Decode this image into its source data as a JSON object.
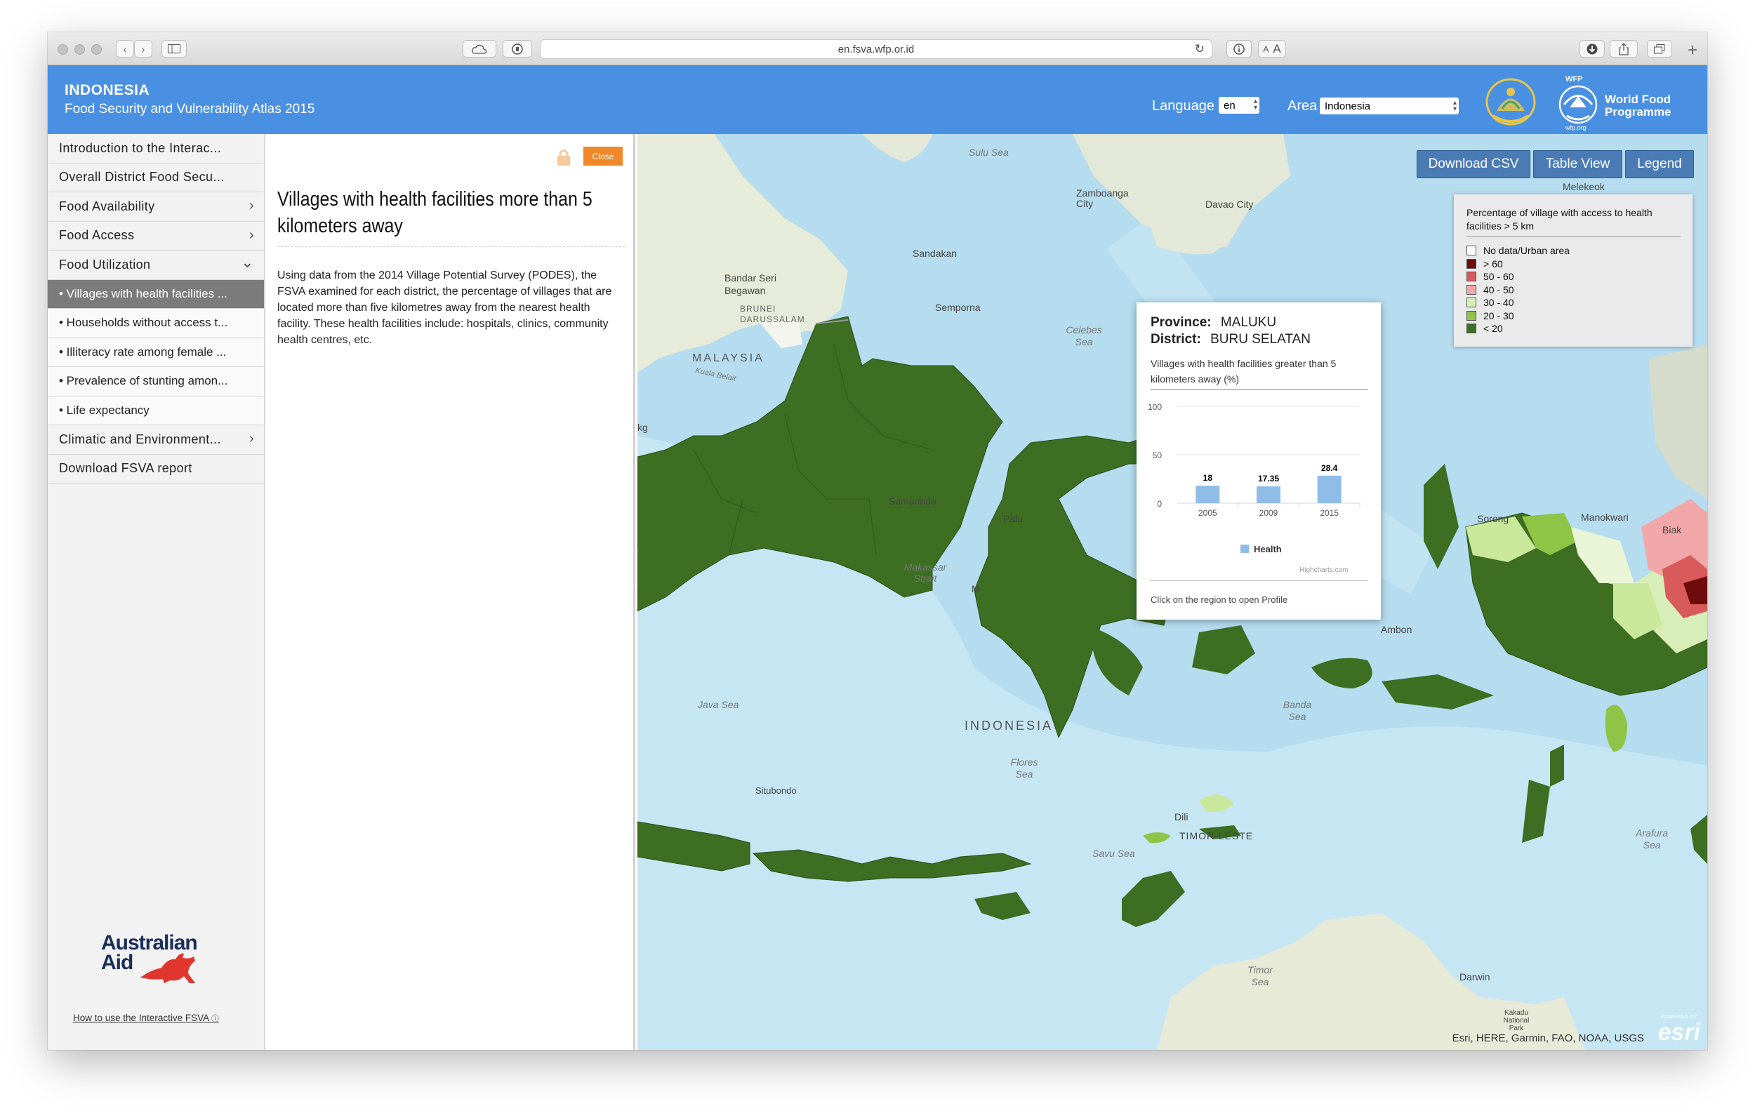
{
  "browser": {
    "url": "en.fsva.wfp.or.id",
    "reader_small": "A",
    "reader_large": "A"
  },
  "header": {
    "title": "INDONESIA",
    "subtitle": "Food Security and Vulnerability Atlas 2015",
    "language_label": "Language",
    "language_value": "en",
    "area_label": "Area",
    "area_value": "Indonesia",
    "wfp_top": "WFP",
    "wfp_line1": "World Food",
    "wfp_line2": "Programme",
    "wfp_url": "wfp.org"
  },
  "sidebar": {
    "items": [
      {
        "label": "Introduction to the Interac...",
        "type": "main"
      },
      {
        "label": "Overall District Food Secu...",
        "type": "main"
      },
      {
        "label": "Food Availability",
        "type": "main",
        "chevron": "›"
      },
      {
        "label": "Food Access",
        "type": "main",
        "chevron": "›"
      },
      {
        "label": "Food Utilization",
        "type": "main",
        "chevron": "⌄"
      },
      {
        "label": "• Villages with health facilities ...",
        "type": "sub",
        "active": true
      },
      {
        "label": "• Households without access t...",
        "type": "sub"
      },
      {
        "label": "• Illiteracy rate among female ...",
        "type": "sub"
      },
      {
        "label": "• Prevalence of stunting amon...",
        "type": "sub"
      },
      {
        "label": "• Life expectancy",
        "type": "sub"
      },
      {
        "label": "Climatic and Environment...",
        "type": "main",
        "chevron": "›"
      },
      {
        "label": "Download FSVA report",
        "type": "main"
      }
    ],
    "aid_line1": "Australian",
    "aid_line2": "Aid",
    "help_link": "How to use the Interactive FSVA"
  },
  "panel": {
    "close_label": "Close",
    "title": "Villages with health facilities more than 5 kilometers away",
    "body": "Using data from the 2014 Village Potential Survey (PODES), the FSVA examined for each district, the percentage of villages that are located more than five kilometres away from the nearest health facility. These health facilities include: hospitals, clinics, community health centres, etc."
  },
  "map": {
    "buttons": {
      "csv": "Download CSV",
      "table": "Table View",
      "legend": "Legend"
    },
    "legend": {
      "title": "Percentage of village with access to health facilities > 5 km",
      "items": [
        {
          "label": "No data/Urban area",
          "color": "#ffffff"
        },
        {
          "label": "> 60",
          "color": "#6e0b0b"
        },
        {
          "label": "50 - 60",
          "color": "#d95a5a"
        },
        {
          "label": "40 - 50",
          "color": "#f2a8a8"
        },
        {
          "label": "30 - 40",
          "color": "#d8eeb8"
        },
        {
          "label": "20 - 30",
          "color": "#8fc447"
        },
        {
          "label": "< 20",
          "color": "#3d6e22"
        }
      ]
    },
    "popup": {
      "province_label": "Province:",
      "province": "MALUKU",
      "district_label": "District:",
      "district": "BURU SELATAN",
      "chart_title": "Villages with health facilities greater than 5 kilometers away (%)",
      "footer": "Click on the region to open Profile",
      "credit": "Highcharts.com"
    },
    "labels": {
      "sulu_sea": "Sulu Sea",
      "zamboanga": "Zamboanga City",
      "davao": "Davao City",
      "melekeok": "Melekeok",
      "sandakan": "Sandakan",
      "bandar": "Bandar Seri Begawan",
      "brunei": "BRUNEI DARUSSALAM",
      "semporna": "Semporna",
      "celebes": "Celebes Sea",
      "malaysia": "MALAYSIA",
      "kuala": "Kuala Belait",
      "samarinda": "Samarinda",
      "palu": "Palu",
      "makassar_strait": "Makassar Strait",
      "manokwari": "Manokwari",
      "sorong": "Sorong",
      "biak": "Biak",
      "ambon": "Ambon",
      "java_sea": "Java Sea",
      "banda_sea": "Banda Sea",
      "indonesia": "INDONESIA",
      "flores": "Flores Sea",
      "situbondo": "Situbondo",
      "dili": "Dili",
      "timor_leste": "TIMOR-LESTE",
      "savu": "Savu Sea",
      "arafura": "Arafura Sea",
      "timor_sea": "Timor Sea",
      "darwin": "Darwin",
      "kakadu": "Kakadu National Park",
      "kg": "kg",
      "m_left": "M"
    },
    "credits": "Esri, HERE, Garmin, FAO, NOAA, USGS",
    "esri": "esri",
    "powered": "POWERED BY"
  },
  "chart_data": {
    "type": "bar",
    "categories": [
      "2005",
      "2009",
      "2015"
    ],
    "series": [
      {
        "name": "Health",
        "values": [
          18,
          17.35,
          28.4
        ]
      }
    ],
    "ylim": [
      0,
      100
    ],
    "yticks": [
      0,
      50,
      100
    ],
    "legend": "bottom",
    "color": "#90bde8"
  }
}
